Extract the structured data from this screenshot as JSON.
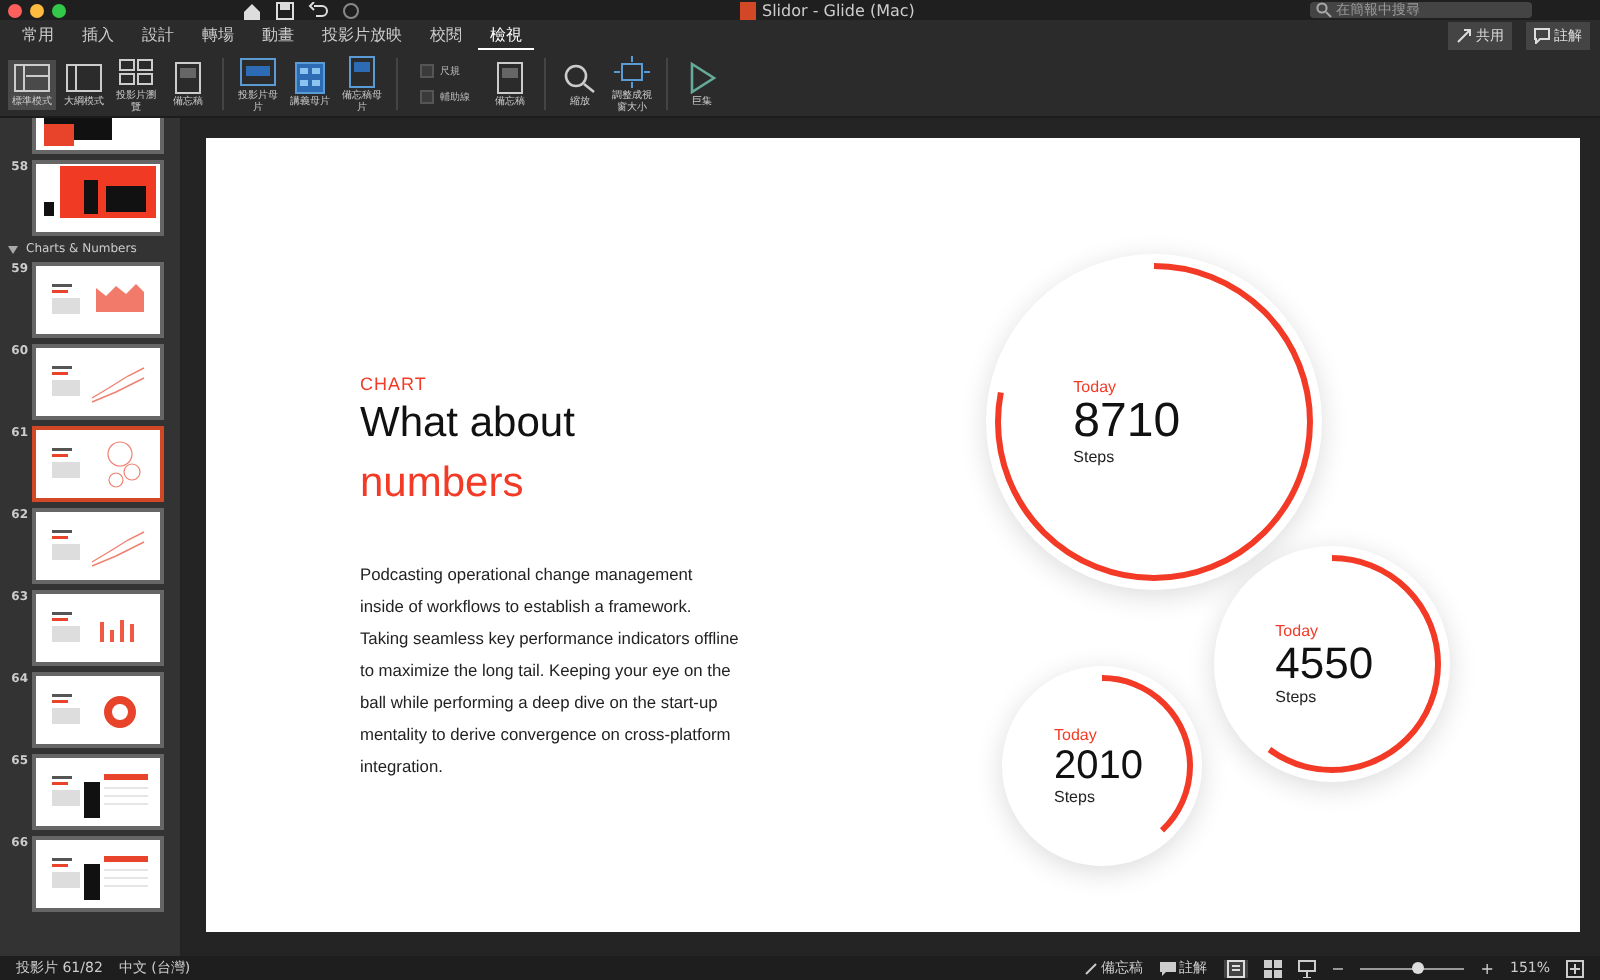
{
  "window": {
    "title": "Slidor - Glide (Mac)",
    "search": {
      "placeholder": "在簡報中搜尋"
    }
  },
  "header_buttons": [
    {
      "label": "共用",
      "kind": "share"
    },
    {
      "label": "註解",
      "kind": "comment"
    }
  ],
  "tabs": [
    {
      "label": "常用",
      "selected": false
    },
    {
      "label": "插入",
      "selected": false
    },
    {
      "label": "設計",
      "selected": false
    },
    {
      "label": "轉場",
      "selected": false
    },
    {
      "label": "動畫",
      "selected": false
    },
    {
      "label": "投影片放映",
      "selected": false
    },
    {
      "label": "校閱",
      "selected": false
    },
    {
      "label": "檢視",
      "selected": true
    }
  ],
  "ribbon": [
    {
      "kind": "button",
      "label": "標準模式",
      "selected": true
    },
    {
      "kind": "button",
      "label": "大綱模式",
      "selected": false
    },
    {
      "kind": "button",
      "label": "投影片瀏覽",
      "selected": false
    },
    {
      "kind": "button",
      "label": "備忘稿",
      "selected": false
    },
    {
      "kind": "sep"
    },
    {
      "kind": "button",
      "label": "投影片母片",
      "selected": false
    },
    {
      "kind": "button",
      "label": "講義母片",
      "selected": false
    },
    {
      "kind": "button",
      "label": "備忘稿母片",
      "selected": false
    },
    {
      "kind": "sep"
    },
    {
      "kind": "checks",
      "items": [
        {
          "label": "尺規",
          "checked": false
        },
        {
          "label": "輔助線",
          "checked": false
        }
      ]
    },
    {
      "kind": "button",
      "label": "備忘稿",
      "selected": false
    },
    {
      "kind": "sep"
    },
    {
      "kind": "button",
      "label": "縮放",
      "selected": false
    },
    {
      "kind": "button",
      "label": "調整成視窗大小",
      "selected": false
    },
    {
      "kind": "sep"
    },
    {
      "kind": "button",
      "label": "巨集",
      "selected": false
    }
  ],
  "sidebar": {
    "items": [
      {
        "kind": "slide",
        "selected": false
      },
      {
        "kind": "slide",
        "number": "58",
        "selected": false
      },
      {
        "kind": "section",
        "label": "Charts & Numbers"
      },
      {
        "kind": "slide",
        "number": "59",
        "selected": false
      },
      {
        "kind": "slide",
        "number": "60",
        "selected": false
      },
      {
        "kind": "slide",
        "number": "61",
        "selected": true
      },
      {
        "kind": "slide",
        "number": "62",
        "selected": false
      },
      {
        "kind": "slide",
        "number": "63",
        "selected": false
      },
      {
        "kind": "slide",
        "number": "64",
        "selected": false
      },
      {
        "kind": "slide",
        "number": "65",
        "selected": false
      },
      {
        "kind": "slide",
        "number": "66",
        "selected": false
      }
    ]
  },
  "slide": {
    "eyebrow": "CHART",
    "title_lines": [
      "What about",
      "numbers"
    ],
    "body": "Podcasting operational change management inside of workflows to establish a framework. Taking seamless key performance indicators offline to maximize the long tail. Keeping your eye on the ball while performing a deep dive on the start-up mentality to derive convergence on cross-platform integration.",
    "stats": [
      {
        "label": "Today",
        "value": "8710",
        "unit": "Steps",
        "level": 0.78
      },
      {
        "label": "Today",
        "value": "4550",
        "unit": "Steps",
        "level": 0.6
      },
      {
        "label": "Today",
        "value": "2010",
        "unit": "Steps",
        "level": 0.38
      }
    ]
  },
  "status_bar": {
    "slide": "投影片 61/82",
    "language": "中文 (台灣)",
    "notes": "備忘稿",
    "comments": "註解",
    "zoom": {
      "out": "−",
      "in": "+",
      "level": 0.55,
      "reading": "151%"
    }
  }
}
